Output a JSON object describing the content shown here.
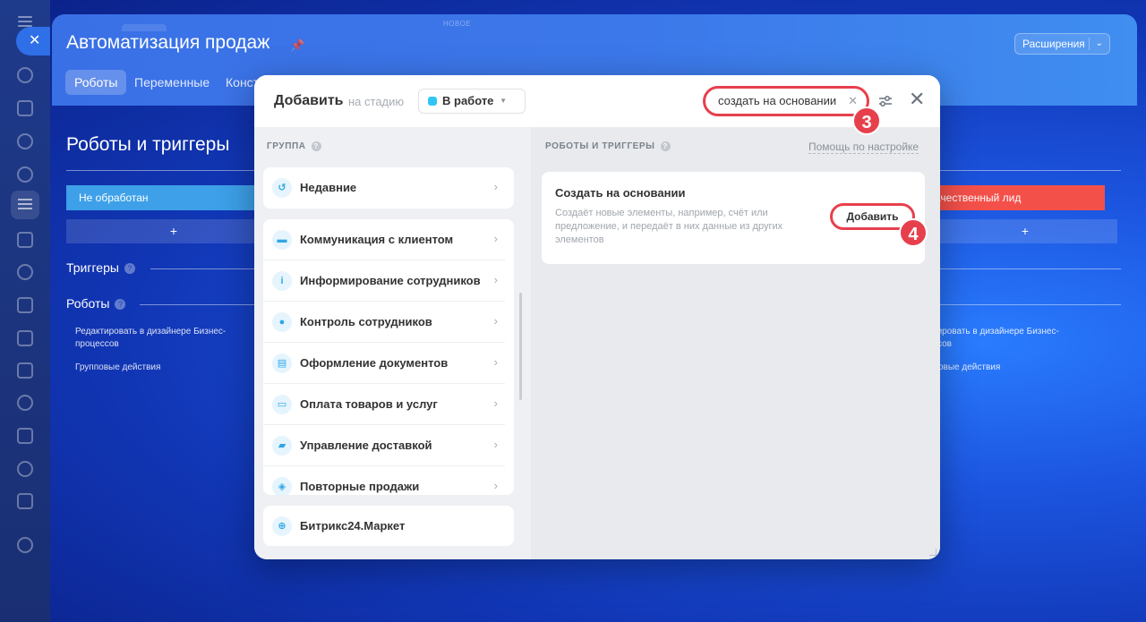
{
  "background": {
    "top_hint": "НОВОЕ",
    "page_title": "Автоматизация продаж",
    "extensions_label": "Расширения",
    "tabs": [
      {
        "label": "Роботы",
        "active": true
      },
      {
        "label": "Переменные",
        "active": false
      },
      {
        "label": "Конст",
        "active": false
      }
    ],
    "section_title": "Роботы и триггеры",
    "stage_left": "Не обработан",
    "stage_right": "ачественный лид",
    "plus_label": "+",
    "triggers_label": "Триггеры",
    "robots_label": "Роботы",
    "edit_link_left": "Редактировать в дизайнере Бизнес-процессов",
    "edit_link_right": "тировать в дизайнере Бизнес-\nссов",
    "group_actions_left": "Групповые действия",
    "group_actions_right": "овые действия"
  },
  "modal": {
    "title": "Добавить",
    "stage_prefix": "на стадию",
    "stage_value": "В работе",
    "search_value": "создать на основании",
    "left_pane_label": "ГРУППА",
    "right_pane_label": "РОБОТЫ И ТРИГГЕРЫ",
    "help_link": "Помощь по настройке",
    "recent": {
      "label": "Недавние",
      "icon": "history-icon"
    },
    "groups": [
      {
        "label": "Коммуникация с клиентом",
        "icon": "chat-icon"
      },
      {
        "label": "Информирование сотрудников",
        "icon": "info-icon"
      },
      {
        "label": "Контроль сотрудников",
        "icon": "users-icon"
      },
      {
        "label": "Оформление документов",
        "icon": "document-icon"
      },
      {
        "label": "Оплата товаров и услуг",
        "icon": "payment-icon"
      },
      {
        "label": "Управление доставкой",
        "icon": "truck-icon"
      },
      {
        "label": "Повторные продажи",
        "icon": "repeat-sales-icon"
      }
    ],
    "market": {
      "label": "Битрикс24.Маркет",
      "icon": "market-bag-icon"
    },
    "result": {
      "title": "Создать на основании",
      "description": "Создаёт новые элементы, например, счёт или предложение, и передаёт в них данные из других элементов",
      "button": "Добавить"
    },
    "badges": {
      "search": "3",
      "add": "4"
    }
  },
  "colors": {
    "accent_red": "#e7404d",
    "stage_blue": "#3da0e8",
    "stage_red": "#f4504a",
    "icon_blue": "#2fa7e6"
  }
}
